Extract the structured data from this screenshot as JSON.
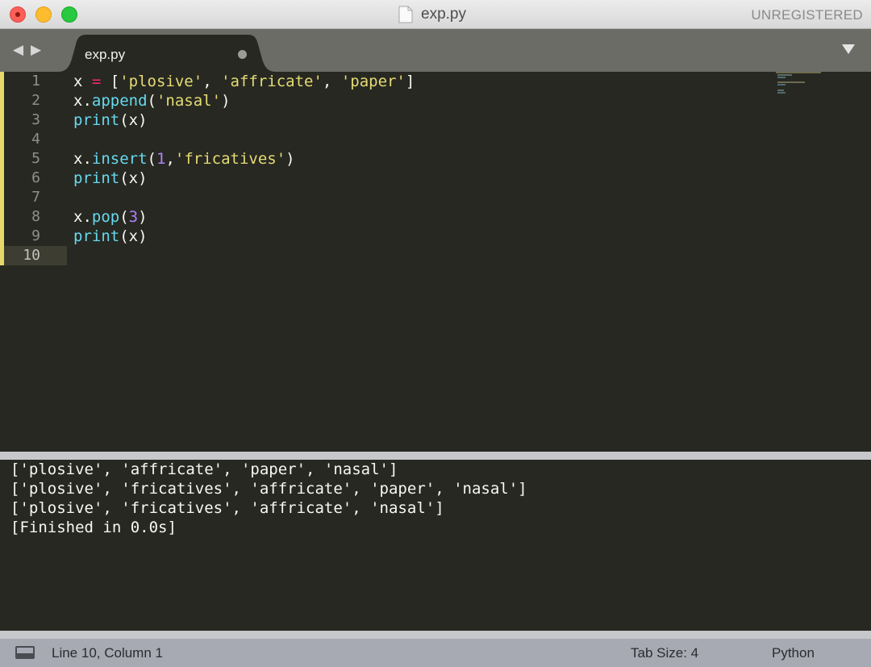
{
  "window": {
    "title": "exp.py",
    "registration_notice": "UNREGISTERED"
  },
  "tabbar": {
    "back_label": "◀",
    "forward_label": "▶",
    "tabs": [
      {
        "label": "exp.py",
        "modified": true
      }
    ]
  },
  "editor": {
    "current_line": 10,
    "line_numbers": [
      "1",
      "2",
      "3",
      "4",
      "5",
      "6",
      "7",
      "8",
      "9",
      "10"
    ],
    "lines": [
      "x = ['plosive', 'affricate', 'paper']",
      "x.append('nasal')",
      "print(x)",
      "",
      "x.insert(1,'fricatives')",
      "print(x)",
      "",
      "x.pop(3)",
      "print(x)",
      ""
    ],
    "colors": {
      "background": "#272822",
      "string": "#e6db74",
      "function": "#66d9ef",
      "number": "#ae81ff",
      "operator": "#f92672",
      "text": "#f8f8f2"
    }
  },
  "output": {
    "lines": [
      "['plosive', 'affricate', 'paper', 'nasal']",
      "['plosive', 'fricatives', 'affricate', 'paper', 'nasal']",
      "['plosive', 'fricatives', 'affricate', 'nasal']",
      "[Finished in 0.0s]"
    ]
  },
  "statusbar": {
    "position": "Line 10, Column 1",
    "tab_size": "Tab Size: 4",
    "syntax": "Python"
  }
}
